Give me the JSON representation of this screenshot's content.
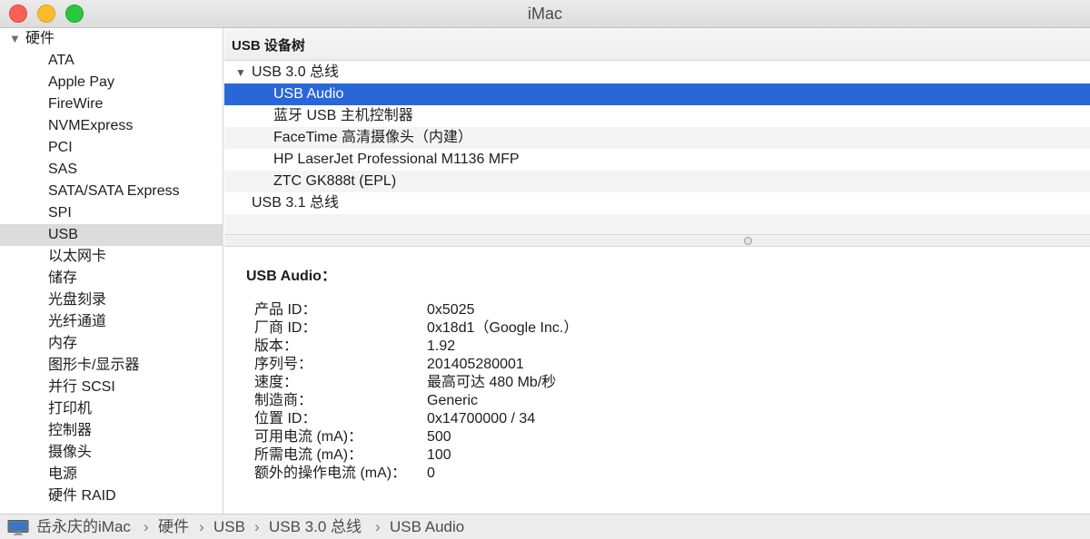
{
  "window": {
    "title": "iMac"
  },
  "sidebar": {
    "group_label": "硬件",
    "items": [
      {
        "label": "ATA"
      },
      {
        "label": "Apple Pay"
      },
      {
        "label": "FireWire"
      },
      {
        "label": "NVMExpress"
      },
      {
        "label": "PCI"
      },
      {
        "label": "SAS"
      },
      {
        "label": "SATA/SATA Express"
      },
      {
        "label": "SPI"
      },
      {
        "label": "USB",
        "selected": true
      },
      {
        "label": "以太网卡"
      },
      {
        "label": "储存"
      },
      {
        "label": "光盘刻录"
      },
      {
        "label": "光纤通道"
      },
      {
        "label": "内存"
      },
      {
        "label": "图形卡/显示器"
      },
      {
        "label": "并行 SCSI"
      },
      {
        "label": "打印机"
      },
      {
        "label": "控制器"
      },
      {
        "label": "摄像头"
      },
      {
        "label": "电源"
      },
      {
        "label": "硬件 RAID"
      }
    ]
  },
  "tree": {
    "header": "USB 设备树",
    "rows": [
      {
        "label": "USB 3.0 总线",
        "expanded": true
      },
      {
        "label": "USB Audio",
        "selected": true
      },
      {
        "label": "蓝牙 USB 主机控制器"
      },
      {
        "label": "FaceTime 高清摄像头（内建）"
      },
      {
        "label": "HP LaserJet Professional M1136 MFP"
      },
      {
        "label": "ZTC GK888t (EPL)"
      },
      {
        "label": "USB 3.1 总线"
      }
    ]
  },
  "detail": {
    "title": "USB Audio：",
    "properties": [
      {
        "key": "产品 ID：",
        "value": "0x5025"
      },
      {
        "key": "厂商 ID：",
        "value": "0x18d1（Google Inc.）"
      },
      {
        "key": "版本：",
        "value": "1.92"
      },
      {
        "key": "序列号：",
        "value": "201405280001"
      },
      {
        "key": "速度：",
        "value": "最高可达 480 Mb/秒"
      },
      {
        "key": "制造商：",
        "value": "Generic"
      },
      {
        "key": "位置 ID：",
        "value": "0x14700000 / 34"
      },
      {
        "key": "可用电流 (mA)：",
        "value": "500"
      },
      {
        "key": "所需电流 (mA)：",
        "value": "100"
      },
      {
        "key": "额外的操作电流 (mA)：",
        "value": "0"
      }
    ]
  },
  "pathbar": {
    "crumbs": [
      "岳永庆的iMac",
      "硬件",
      "USB",
      "USB 3.0 总线",
      "USB Audio"
    ],
    "separator": "›",
    "icon": "imac-icon"
  },
  "colors": {
    "selection": "#2966d8",
    "sidebar_selected": "#dcdcdc"
  }
}
